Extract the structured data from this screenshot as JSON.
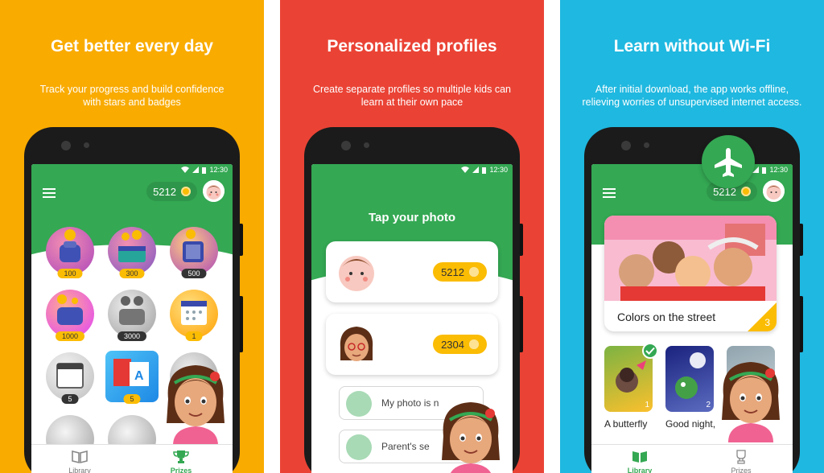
{
  "panels": [
    {
      "title": "Get better every day",
      "subtitle_1": "Track your progress and build confidence",
      "subtitle_2": "with stars and badges",
      "status_time": "12:30",
      "points": "5212",
      "badges": [
        "100",
        "300",
        "500",
        "1000",
        "3000",
        "1",
        "5",
        "5"
      ],
      "nav_library": "Library",
      "nav_prizes": "Prizes"
    },
    {
      "title": "Personalized profiles",
      "subtitle_1": "Create separate profiles so multiple kids can",
      "subtitle_2": "learn at their own pace",
      "status_time": "12:30",
      "heading": "Tap your photo",
      "profiles": [
        {
          "points": "5212"
        },
        {
          "points": "2304"
        }
      ],
      "option_photo": "My photo is n",
      "option_parent": "Parent's se"
    },
    {
      "title": "Learn without Wi-Fi",
      "subtitle_1": "After initial download, the app works offline,",
      "subtitle_2": "relieving worries of unsupervised internet access.",
      "status_time": "12:30",
      "points": "5212",
      "featured_title": "Colors on the street",
      "featured_level": "3",
      "books": [
        {
          "title": "A butterfly",
          "level": "1"
        },
        {
          "title": "Good night,",
          "level": "2"
        }
      ],
      "nav_library": "Library",
      "nav_prizes": "Prizes"
    }
  ],
  "colors": {
    "yellow": "#f9ab00",
    "red": "#ea4335",
    "blue": "#1fb8e0",
    "green": "#34a853",
    "gold": "#fbbc04"
  },
  "icons": [
    "menu-icon",
    "flower-icon",
    "wifi-icon",
    "battery-icon",
    "library-icon",
    "trophy-icon",
    "airplane-icon",
    "check-icon"
  ]
}
